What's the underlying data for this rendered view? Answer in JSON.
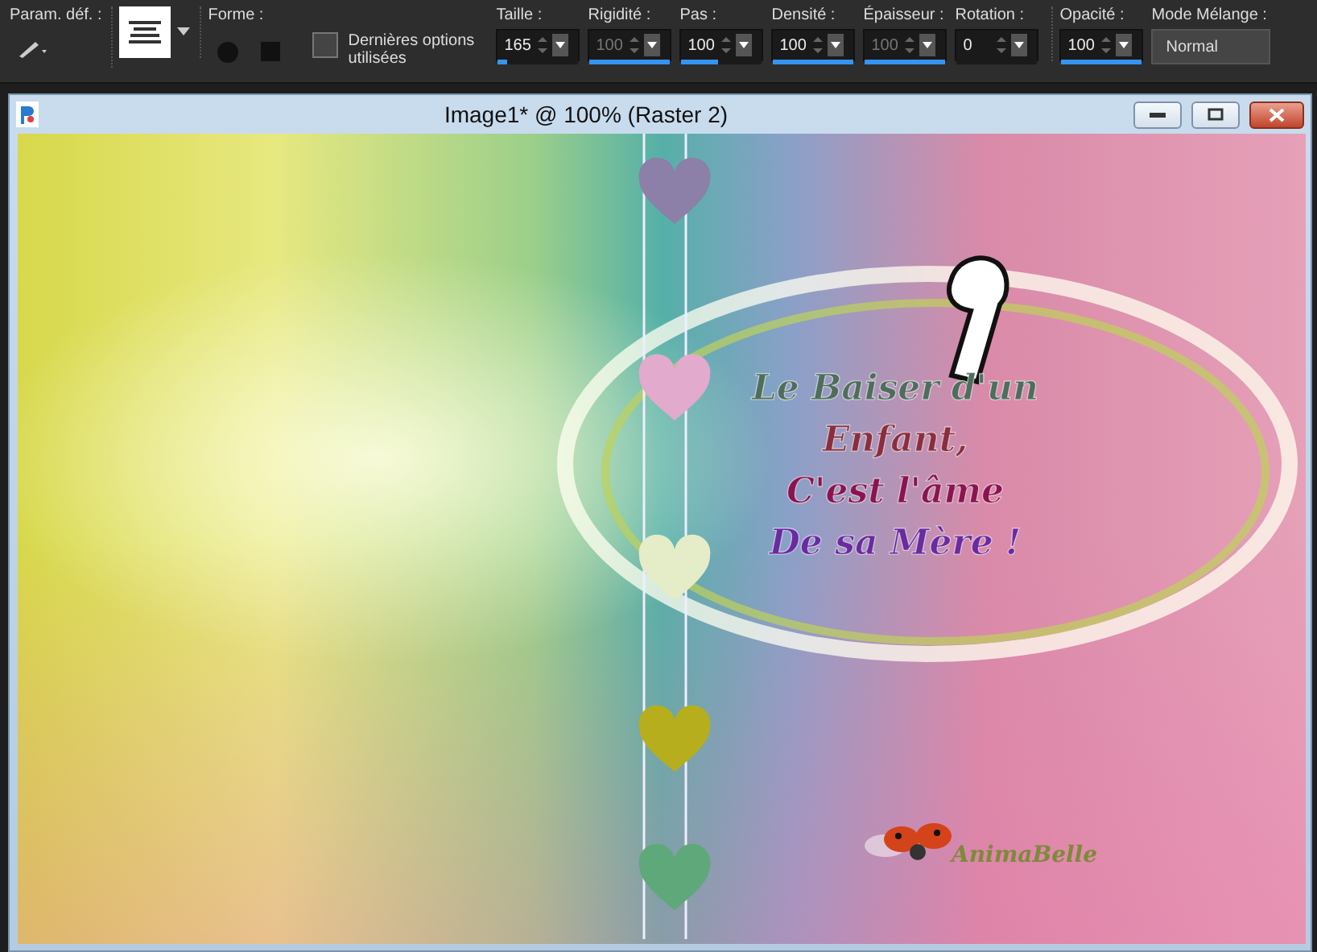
{
  "toolbar": {
    "preset": {
      "label": "Param. déf. :"
    },
    "shape": {
      "label": "Forme :"
    },
    "last_options": {
      "label": "Dernières options utilisées",
      "checked": false
    },
    "fields": [
      {
        "label": "Taille :",
        "value": "165",
        "level": 0.12,
        "disabled": false
      },
      {
        "label": "Rigidité :",
        "value": "100",
        "level": 1,
        "disabled": true
      },
      {
        "label": "Pas :",
        "value": "100",
        "level": 0.45,
        "disabled": false
      },
      {
        "label": "Densité :",
        "value": "100",
        "level": 1,
        "disabled": false
      },
      {
        "label": "Épaisseur :",
        "value": "100",
        "level": 1,
        "disabled": true
      },
      {
        "label": "Rotation :",
        "value": "0",
        "level": 0,
        "disabled": false
      },
      {
        "label": "Opacité :",
        "value": "100",
        "level": 1,
        "disabled": false
      }
    ],
    "blend": {
      "label": "Mode Mélange :",
      "value": "Normal"
    }
  },
  "window": {
    "title": "Image1* @ 100% (Raster 2)"
  },
  "canvas": {
    "hearts": [
      {
        "color": "#8c7fa8"
      },
      {
        "color": "#e2aacd"
      },
      {
        "color": "#e4ecc8"
      },
      {
        "color": "#b6ae1c"
      },
      {
        "color": "#5fa87a"
      }
    ],
    "poem": [
      {
        "text": "Le Baiser d'un",
        "color": "#4f6d5c"
      },
      {
        "text": "Enfant,",
        "color": "#8a2e3e"
      },
      {
        "text": "C'est l'âme",
        "color": "#8a1450"
      },
      {
        "text": "De sa Mère !",
        "color": "#6a2aa0"
      }
    ],
    "signature": "AnimaBelle"
  }
}
